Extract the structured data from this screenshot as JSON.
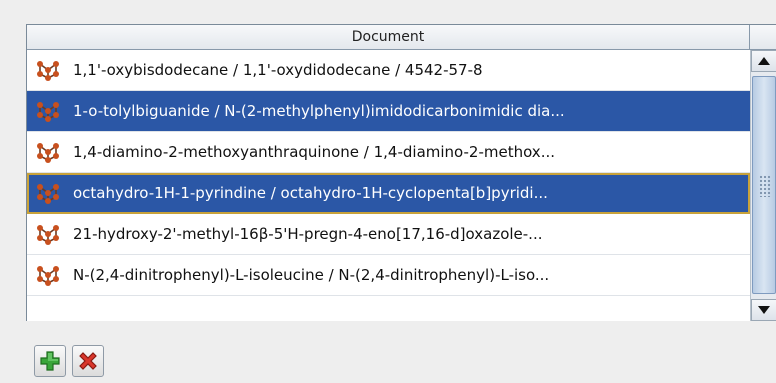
{
  "table": {
    "column_header": "Document",
    "rows": [
      {
        "text": "1,1'-oxybisdodecane / 1,1'-oxydidodecane / 4542-57-8",
        "selected": false
      },
      {
        "text": "1-o-tolylbiguanide / N-(2-methylphenyl)imidodicarbonimidic dia...",
        "selected": true
      },
      {
        "text": "1,4-diamino-2-methoxyanthraquinone / 1,4-diamino-2-methox...",
        "selected": false
      },
      {
        "text": "octahydro-1H-1-pyrindine / octahydro-1H-cyclopenta[b]pyridi...",
        "selected": true
      },
      {
        "text": "21-hydroxy-2'-methyl-16β-5'H-pregn-4-eno[17,16-d]oxazole-...",
        "selected": false
      },
      {
        "text": "N-(2,4-dinitrophenyl)-L-isoleucine / N-(2,4-dinitrophenyl)-L-iso...",
        "selected": false
      }
    ],
    "row_icon": "molecule-icon"
  },
  "toolbar": {
    "add_icon": "add-icon",
    "remove_icon": "remove-icon"
  },
  "colors": {
    "selection": "#2b57a6",
    "focus_border": "#c8a23a",
    "add_green": "#3aa63a",
    "remove_red": "#d9362b",
    "molecule_orange": "#c8501e"
  }
}
